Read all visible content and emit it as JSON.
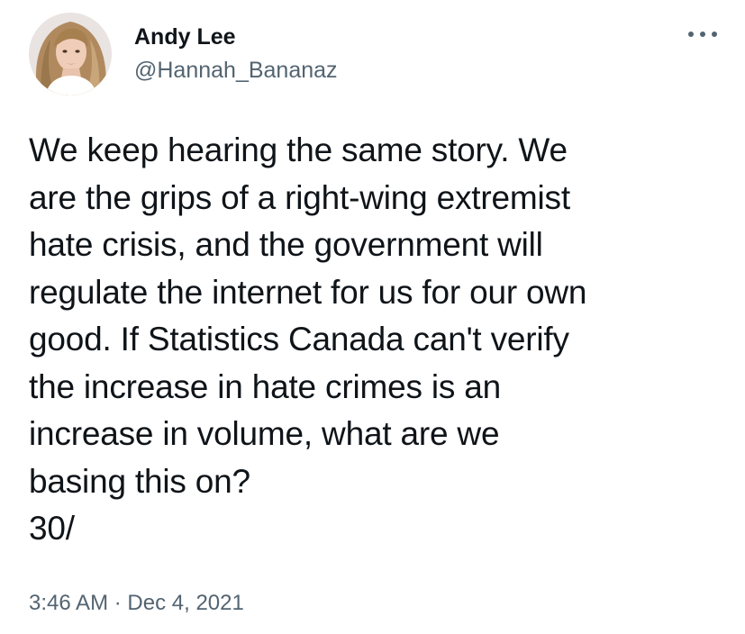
{
  "author": {
    "display_name": "Andy Lee",
    "handle": "@Hannah_Bananaz",
    "avatar_icon": "profile-photo"
  },
  "menu": {
    "icon": "more-options-icon"
  },
  "tweet": {
    "lines": [
      "We keep hearing the same story. We",
      "are the grips of a right-wing extremist",
      "hate crisis, and the government will",
      "regulate the internet for us for our own",
      "good. If Statistics Canada can't verify",
      "the increase in hate crimes is an",
      "increase in volume, what are we",
      "basing this on?",
      "30/"
    ],
    "time": "3:46 AM",
    "separator": "·",
    "date": "Dec 4, 2021"
  },
  "colors": {
    "text": "#0f1419",
    "secondary": "#536471"
  }
}
